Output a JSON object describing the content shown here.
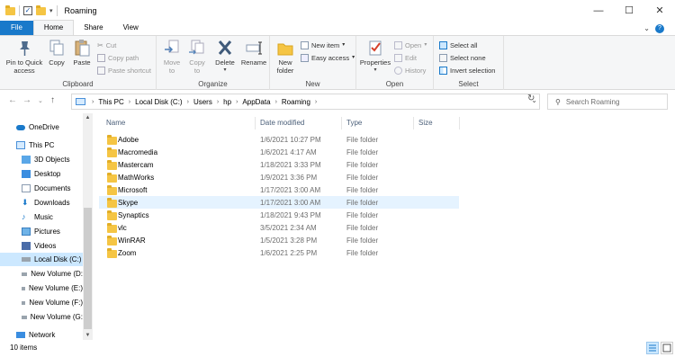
{
  "window": {
    "title": "Roaming"
  },
  "tabs": [
    "File",
    "Home",
    "Share",
    "View"
  ],
  "ribbon": {
    "clipboard": {
      "label": "Clipboard",
      "pin": "Pin to Quick\naccess",
      "copy": "Copy",
      "paste": "Paste",
      "cut": "Cut",
      "copy_path": "Copy path",
      "paste_shortcut": "Paste shortcut"
    },
    "organize": {
      "label": "Organize",
      "move_to": "Move\nto",
      "copy_to": "Copy\nto",
      "delete": "Delete",
      "rename": "Rename"
    },
    "new": {
      "label": "New",
      "new_folder": "New\nfolder",
      "new_item": "New item",
      "easy_access": "Easy access"
    },
    "open": {
      "label": "Open",
      "properties": "Properties",
      "open": "Open",
      "edit": "Edit",
      "history": "History"
    },
    "select": {
      "label": "Select",
      "select_all": "Select all",
      "select_none": "Select none",
      "invert": "Invert selection"
    }
  },
  "address": {
    "crumbs": [
      "This PC",
      "Local Disk (C:)",
      "Users",
      "hp",
      "AppData",
      "Roaming"
    ],
    "search_placeholder": "Search Roaming"
  },
  "nav": [
    {
      "label": "OneDrive",
      "icon": "cloud-icon"
    },
    {
      "label": "This PC",
      "icon": "pc-icon"
    },
    {
      "label": "3D Objects",
      "icon": "cube-icon"
    },
    {
      "label": "Desktop",
      "icon": "desktop-icon"
    },
    {
      "label": "Documents",
      "icon": "documents-icon"
    },
    {
      "label": "Downloads",
      "icon": "download-icon"
    },
    {
      "label": "Music",
      "icon": "music-icon"
    },
    {
      "label": "Pictures",
      "icon": "pictures-icon"
    },
    {
      "label": "Videos",
      "icon": "videos-icon"
    },
    {
      "label": "Local Disk (C:)",
      "icon": "drive-icon",
      "selected": true
    },
    {
      "label": "New Volume (D:",
      "icon": "drive-icon"
    },
    {
      "label": "New Volume (E:)",
      "icon": "drive-icon"
    },
    {
      "label": "New Volume (F:)",
      "icon": "drive-icon"
    },
    {
      "label": "New Volume (G:",
      "icon": "drive-icon"
    },
    {
      "label": "Network",
      "icon": "network-icon"
    }
  ],
  "columns": [
    "Name",
    "Date modified",
    "Type",
    "Size"
  ],
  "files": [
    {
      "name": "Adobe",
      "date": "1/6/2021 10:27 PM",
      "type": "File folder"
    },
    {
      "name": "Macromedia",
      "date": "1/6/2021 4:17 AM",
      "type": "File folder"
    },
    {
      "name": "Mastercam",
      "date": "1/18/2021 3:33 PM",
      "type": "File folder"
    },
    {
      "name": "MathWorks",
      "date": "1/9/2021 3:36 PM",
      "type": "File folder"
    },
    {
      "name": "Microsoft",
      "date": "1/17/2021 3:00 AM",
      "type": "File folder"
    },
    {
      "name": "Skype",
      "date": "1/17/2021 3:00 AM",
      "type": "File folder",
      "selected": true
    },
    {
      "name": "Synaptics",
      "date": "1/18/2021 9:43 PM",
      "type": "File folder"
    },
    {
      "name": "vlc",
      "date": "3/5/2021 2:34 AM",
      "type": "File folder"
    },
    {
      "name": "WinRAR",
      "date": "1/5/2021 3:28 PM",
      "type": "File folder"
    },
    {
      "name": "Zoom",
      "date": "1/6/2021 2:25 PM",
      "type": "File folder"
    }
  ],
  "status": {
    "count": "10 items"
  },
  "colors": {
    "accent": "#1979ca",
    "folder": "#f5c544",
    "selection": "#cce8ff",
    "hover_row": "#e5f3ff"
  }
}
